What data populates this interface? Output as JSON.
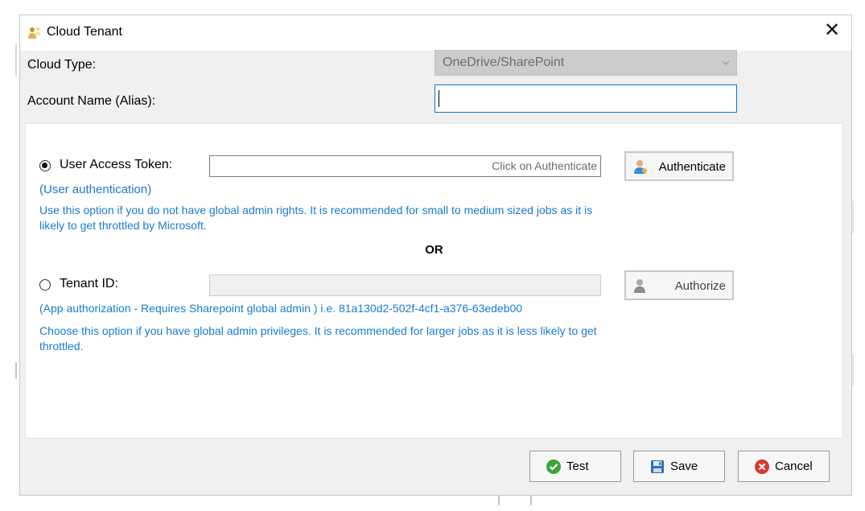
{
  "dialog": {
    "title": "Cloud Tenant",
    "close_glyph": "✕"
  },
  "form": {
    "cloud_type_label": "Cloud Type:",
    "cloud_type_value": "OneDrive/SharePoint",
    "account_name_label": "Account Name (Alias):",
    "account_name_value": ""
  },
  "user_token": {
    "selected": true,
    "label": "User Access Token:",
    "placeholder": "Click on Authenticate",
    "button": "Authenticate",
    "sub_label": "(User authentication)",
    "description_line1": "Use this option if you do not have global admin rights. It is recommended for small to medium sized jobs as it is",
    "description_line2": "likely to get throttled by Microsoft."
  },
  "separator": "OR",
  "tenant": {
    "selected": false,
    "label": "Tenant ID:",
    "button": "Authorize",
    "sub_label": "(App authorization - Requires Sharepoint global admin )   i.e. 81a130d2-502f-4cf1-a376-63edeb00",
    "description_line1": "Choose this option if you have global admin privileges. It is recommended for larger jobs as it is less likely to get",
    "description_line2": "throttled."
  },
  "footer": {
    "test": "Test",
    "save": "Save",
    "cancel": "Cancel"
  },
  "colors": {
    "info_text": "#1a7bd1",
    "focus_border": "#0078d7",
    "test_icon": "#3aa53a",
    "cancel_icon": "#d9382c"
  },
  "icons": {
    "title": "users-icon",
    "authenticate": "user-icon",
    "authorize": "user-icon",
    "test": "check-circle-icon",
    "save": "save-icon",
    "cancel": "x-circle-icon"
  }
}
